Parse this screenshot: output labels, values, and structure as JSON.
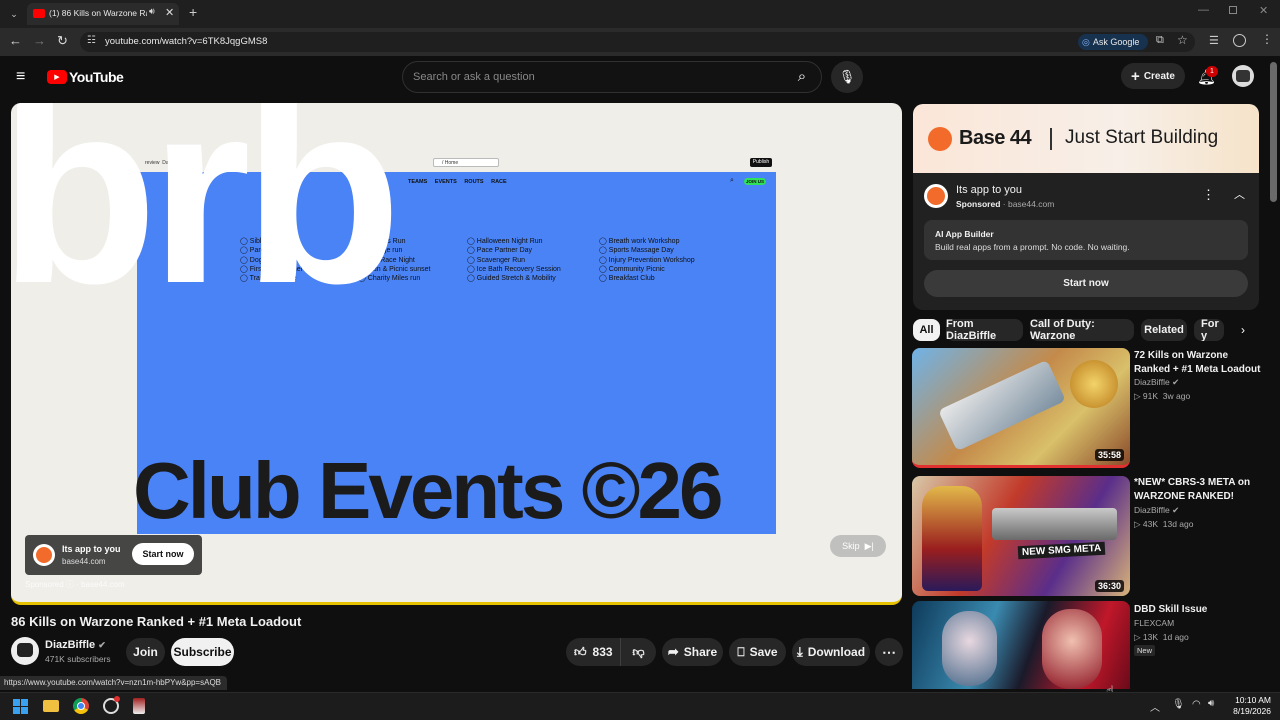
{
  "browser": {
    "tab_title": "(1) 86 Kills on Warzone Ran",
    "url": "youtube.com/watch?v=6TK8JqgGMS8",
    "ask_google": "Ask Google",
    "status_url": "https://www.youtube.com/watch?v=nzn1m-hbPYw&pp=sAQB"
  },
  "header": {
    "logo": "YouTube",
    "search_placeholder": "Search or ask a question",
    "create": "Create",
    "notif_count": "1"
  },
  "player": {
    "overlay_text": "brb",
    "ad_headline": "Club Events ©26",
    "ad_nav": [
      "TEAMS",
      "EVENTS",
      "ROUTS",
      "RACE"
    ],
    "ad_crumb": "/ Home",
    "ad_publish": "Publish",
    "ad_join": "JOIN US",
    "ad_left_tabs": [
      "review",
      "Dashbo"
    ],
    "events_col1": [
      "Siblings",
      "Parents",
      "Dog Jog",
      "First 5K Together",
      "Trail Adventure"
    ],
    "events_col2": [
      "dmarks Run",
      "allenge run",
      "lley Race Night",
      "Run & Picnic sunset",
      "Charity Miles run"
    ],
    "events_col3": [
      "Halloween Night Run",
      "Pace Partner Day",
      "Scavenger Run",
      "Ice Bath Recovery Session",
      "Guided Stretch & Mobility"
    ],
    "events_col4": [
      "Breath work Workshop",
      "Sports Massage Day",
      "Injury Prevention Workshop",
      "Community Picnic",
      "Breakfast Club"
    ],
    "ad_card_title": "Its app to you",
    "ad_card_domain": "base44.com",
    "ad_card_cta": "Start now",
    "sponsored": "Sponsored",
    "sponsored_domain": "base44.com",
    "skip": "Skip"
  },
  "video": {
    "title": "86 Kills on Warzone Ranked + #1 Meta Loadout",
    "channel": "DiazBiffle",
    "subscribers": "471K subscribers",
    "join": "Join",
    "subscribe": "Subscribe",
    "likes": "833",
    "share": "Share",
    "save": "Save",
    "download": "Download"
  },
  "ad_panel": {
    "banner_brand": "Base 44",
    "banner_tagline": "Just Start Building",
    "title": "Its app to you",
    "sponsored": "Sponsored",
    "domain": "base44.com",
    "box_title": "AI App Builder",
    "box_desc": "Build real apps from a prompt. No code. No waiting.",
    "cta": "Start now"
  },
  "chips": [
    "All",
    "From DiazBiffle",
    "Call of Duty: Warzone",
    "Related",
    "For y"
  ],
  "related": [
    {
      "title": "72 Kills on Warzone Ranked + #1 Meta Loadout",
      "channel": "DiazBiffle",
      "views": "91K",
      "age": "3w ago",
      "duration": "35:58",
      "verified": true,
      "badge": ""
    },
    {
      "title": "*NEW* CBRS-3 META on WARZONE RANKED!",
      "channel": "DiazBiffle",
      "views": "43K",
      "age": "13d ago",
      "duration": "36:30",
      "verified": true,
      "badge": "",
      "thumb_text": "NEW SMG META"
    },
    {
      "title": "DBD Skill Issue",
      "channel": "FLEXCAM",
      "views": "13K",
      "age": "1d ago",
      "duration": "",
      "verified": false,
      "badge": "New"
    }
  ],
  "taskbar": {
    "time": "10:10 AM",
    "date": "8/19/2026"
  },
  "colors": {
    "youtube_red": "#ff0000",
    "ad_blue": "#4a83f5",
    "base44_orange": "#f26b2a",
    "progress_yellow": "#e5c100"
  }
}
